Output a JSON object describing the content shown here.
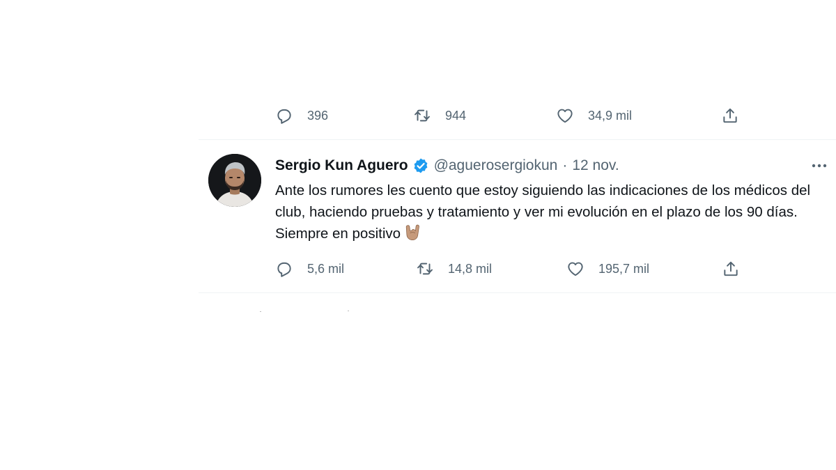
{
  "previous_tweet": {
    "replies": "396",
    "retweets": "944",
    "likes": "34,9 mil"
  },
  "tweet": {
    "display_name": "Sergio Kun Aguero",
    "verified": true,
    "handle": "@aguerosergiokun",
    "separator": "·",
    "date": "12 nov.",
    "text": "Ante los rumores les cuento que estoy siguiendo las indicaciones de los médicos del club, haciendo pruebas y tratamiento y ver mi evolución en el plazo de los 90 días. Siempre en positivo",
    "emoji": "sign-of-the-horns",
    "replies": "5,6 mil",
    "retweets": "14,8 mil",
    "likes": "195,7 mil"
  },
  "icons": {
    "reply": "reply-icon",
    "retweet": "retweet-icon",
    "like": "like-icon",
    "share": "share-icon",
    "more": "more-icon",
    "verified": "verified-badge-icon"
  },
  "colors": {
    "text_primary": "#0f1419",
    "text_secondary": "#536471",
    "verified": "#1d9bf0",
    "divider": "#eff3f4"
  }
}
